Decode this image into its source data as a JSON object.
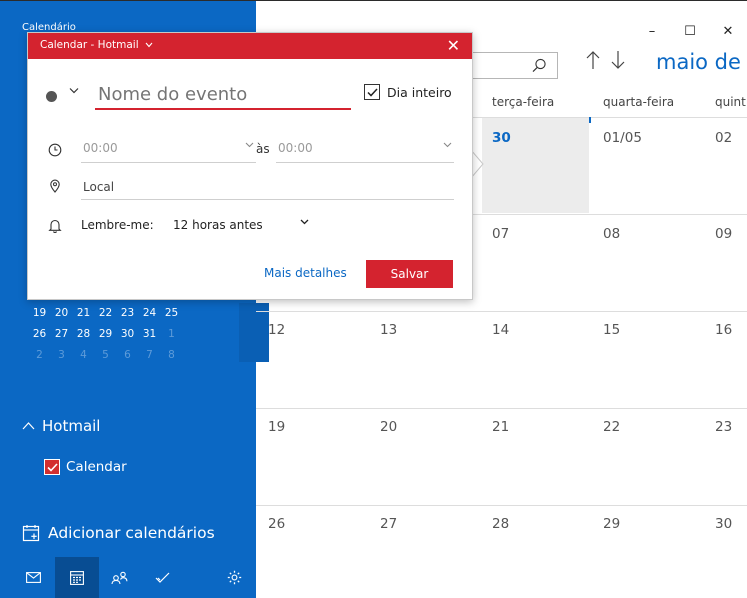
{
  "app": {
    "title": "Calendário"
  },
  "window": {
    "minimize": "–",
    "maximize": "☐",
    "close": "✕"
  },
  "toolbar": {
    "month_title": "maio de"
  },
  "day_headers": [
    "terça-feira",
    "quarta-feira",
    "quint"
  ],
  "weeks": [
    [
      "",
      "",
      "30",
      "01/05",
      "02"
    ],
    [
      "",
      "",
      "07",
      "08",
      "09"
    ],
    [
      "12",
      "13",
      "14",
      "15",
      "16"
    ],
    [
      "19",
      "20",
      "21",
      "22",
      "23"
    ],
    [
      "26",
      "27",
      "28",
      "29",
      "30"
    ]
  ],
  "mini_calendar": {
    "rows": [
      [
        "19",
        "20",
        "21",
        "22",
        "23",
        "24",
        "25"
      ],
      [
        "26",
        "27",
        "28",
        "29",
        "30",
        "31",
        "1"
      ],
      [
        "2",
        "3",
        "4",
        "5",
        "6",
        "7",
        "8"
      ]
    ]
  },
  "sidebar": {
    "account": "Hotmail",
    "calendar_item": "Calendar",
    "add_calendars": "Adicionar calendários"
  },
  "popup": {
    "title": "Calendar - Hotmail",
    "event_name_placeholder": "Nome do evento",
    "all_day_label": "Dia inteiro",
    "all_day_checked": true,
    "start_time": "00:00",
    "to_label": "às",
    "end_time": "00:00",
    "location_placeholder": "Local",
    "reminder_label": "Lembre-me:",
    "reminder_value": "12 horas antes",
    "more_details": "Mais detalhes",
    "save": "Salvar"
  },
  "colors": {
    "sidebar": "#0b68c4",
    "accent_red": "#d4232f",
    "today_bg": "#ececec"
  },
  "icons": [
    "search-icon",
    "arrow-up-icon",
    "arrow-down-icon",
    "clock-icon",
    "location-icon",
    "bell-icon",
    "mail-icon",
    "calendar-icon",
    "people-icon",
    "todo-icon",
    "settings-icon",
    "add-calendar-icon"
  ]
}
